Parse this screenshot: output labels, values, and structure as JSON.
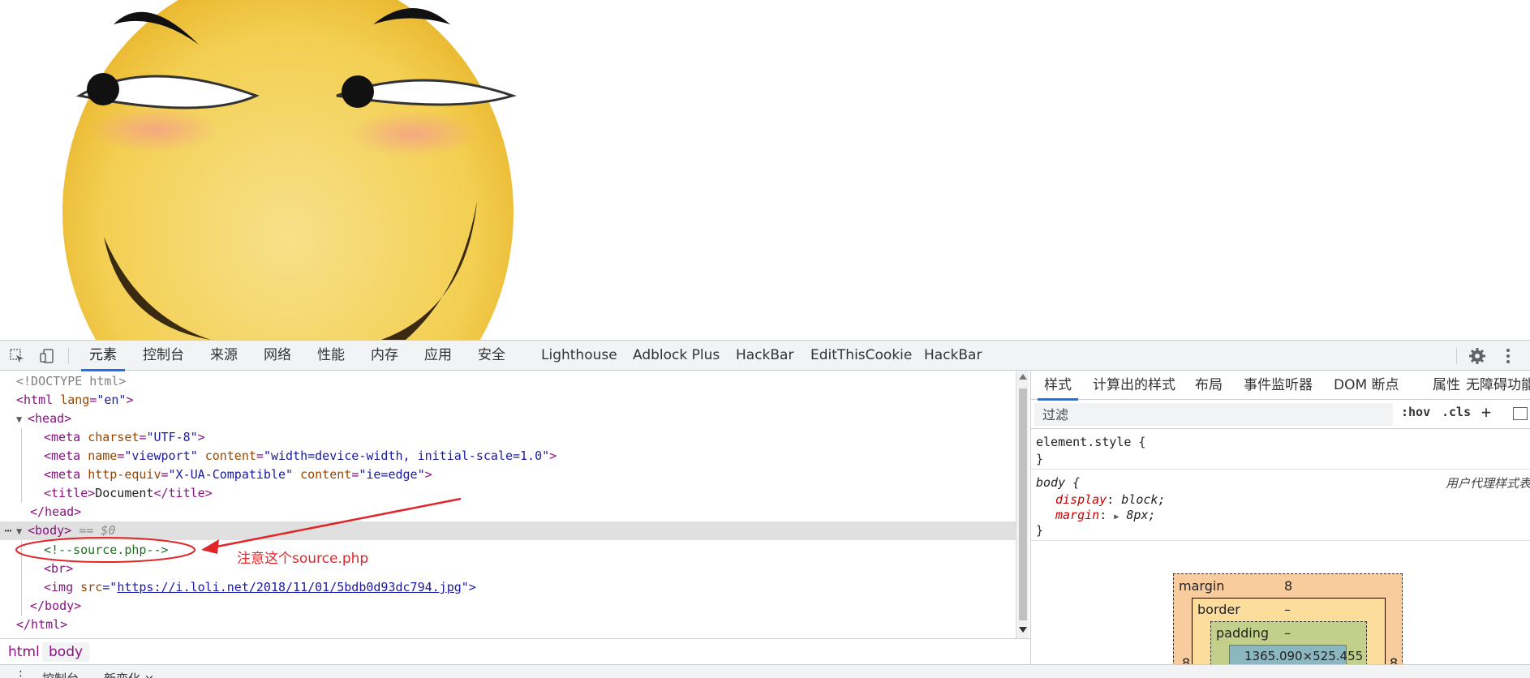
{
  "devtools": {
    "toolbar": {
      "tabs": [
        "元素",
        "控制台",
        "来源",
        "网络",
        "性能",
        "内存",
        "应用",
        "安全",
        "Lighthouse",
        "Adblock Plus",
        "HackBar",
        "EditThisCookie",
        "HackBar"
      ],
      "active_tab": "元素"
    },
    "elements": {
      "lines": {
        "doctype": "<!DOCTYPE html>",
        "html_open": {
          "tag": "<html",
          "attr": "lang",
          "val": "\"en\"",
          "close": ">"
        },
        "head_open": "<head>",
        "meta1": {
          "tag": "<meta",
          "attr": "charset",
          "val": "\"UTF-8\"",
          "close": ">"
        },
        "meta2": {
          "tag": "<meta",
          "attr1": "name",
          "val1": "\"viewport\"",
          "attr2": "content",
          "val2": "\"width=device-width, initial-scale=1.0\"",
          "close": ">"
        },
        "meta3": {
          "tag": "<meta",
          "attr1": "http-equiv",
          "val1": "\"X-UA-Compatible\"",
          "attr2": "content",
          "val2": "\"ie=edge\"",
          "close": ">"
        },
        "title": {
          "open": "<title>",
          "text": "Document",
          "close": "</title>"
        },
        "head_close": "</head>",
        "body_open": "<body>",
        "body_eq": "== $0",
        "comment": "<!--source.php-->",
        "br": "<br>",
        "img": {
          "tag": "<img",
          "attr": "src",
          "q1": "=\"",
          "url": "https://i.loli.net/2018/11/01/5bdb0d93dc794.jpg",
          "q2": "\">"
        },
        "body_close": "</body>",
        "html_close": "</html>"
      },
      "annotation": "注意这个source.php"
    },
    "breadcrumb": [
      "html",
      "body"
    ],
    "drawer": {
      "tabs": [
        "控制台",
        "新变化 ×"
      ]
    },
    "styles": {
      "tabs": [
        "样式",
        "计算出的样式",
        "布局",
        "事件监听器",
        "DOM 断点",
        "属性",
        "无障碍功能"
      ],
      "active_tab": "样式",
      "filter_placeholder": "过滤",
      "hov": ":hov",
      "cls": ".cls",
      "plus": "+",
      "element_style": {
        "selector": "element.style {",
        "close": "}"
      },
      "body_rule": {
        "selector": "body {",
        "source": "用户代理样式表",
        "props": [
          {
            "name": "display",
            "value": "block;"
          },
          {
            "name": "margin",
            "value": "8px;"
          }
        ],
        "close": "}"
      },
      "box_model": {
        "margin_label": "margin",
        "margin_value": "8",
        "border_label": "border",
        "border_value": "–",
        "padding_label": "padding",
        "padding_value": "–",
        "content_size": "1365.090×525.455",
        "side_left": "8",
        "side_right": "8"
      }
    }
  },
  "colors": {
    "accent": "#1a73e8",
    "annotation": "#e0262a",
    "face": "#f4d150"
  }
}
